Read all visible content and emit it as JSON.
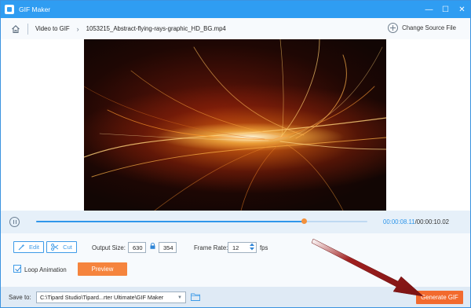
{
  "window": {
    "title": "GIF Maker",
    "controls": {
      "minimize": "—",
      "maximize": "☐",
      "close": "✕"
    }
  },
  "breadcrumb": {
    "items": [
      "Video to GIF",
      "1053215_Abstract-flying-rays-graphic_HD_BG.mp4"
    ],
    "change_source": "Change Source File"
  },
  "playback": {
    "progress": 0.81,
    "time_current": "00:00:08.11",
    "time_separator": "/",
    "time_total": "00:00:10.02"
  },
  "options": {
    "edit_label": "Edit",
    "cut_label": "Cut",
    "output_size_label": "Output Size:",
    "width": "630",
    "height": "354",
    "frame_rate_label": "Frame Rate:",
    "frame_rate": "12",
    "fps_unit": "fps",
    "loop_label": "Loop Animation",
    "loop_checked": true,
    "preview_label": "Preview"
  },
  "footer": {
    "save_to_label": "Save to:",
    "save_path": "C:\\Tipard Studio\\Tipard...rter Ultimate\\GIF Maker",
    "generate_label": "Generate GIF"
  },
  "colors": {
    "titlebar": "#2f9df2",
    "accent_blue": "#2f96ea",
    "preview_orange": "#f5843d",
    "generate_orange": "#f26a2e",
    "annotation_arrow": "#8b1a1a"
  }
}
